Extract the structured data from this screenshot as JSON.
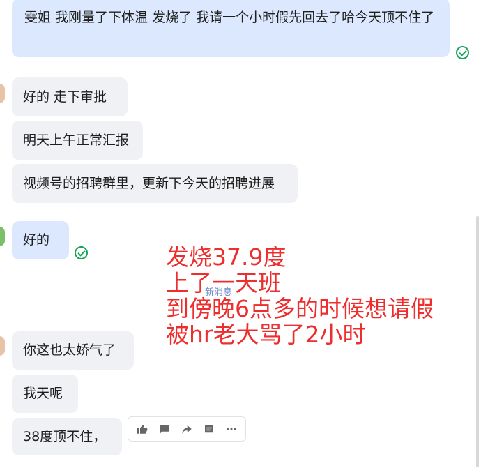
{
  "messages": [
    {
      "text": "雯姐 我刚量了下体温 发烧了 我请一个小时假先回去了哈今天顶不住了"
    },
    {
      "text": "好的  走下审批"
    },
    {
      "text": "明天上午正常汇报"
    },
    {
      "text": "视频号的招聘群里，更新下今天的招聘进展"
    },
    {
      "text": "好的"
    },
    {
      "text": "你这也太娇气了"
    },
    {
      "text": "我天呢"
    },
    {
      "text": "38度顶不住，"
    }
  ],
  "divider": {
    "label": "新消息"
  },
  "annotation": {
    "lines": [
      "发烧37.9度",
      "上了一天班",
      "到傍晚6点多的时候想请假",
      "被hr老大骂了2小时"
    ],
    "color": "#ee2d2d"
  },
  "colors": {
    "self_bubble": "#dbe8fd",
    "other_bubble": "#f0f1f4",
    "read_check": "#18a35b"
  },
  "reaction_bar": {
    "icons": [
      "thumbs-up-icon",
      "comment-icon",
      "forward-icon",
      "quote-icon",
      "more-icon"
    ]
  }
}
